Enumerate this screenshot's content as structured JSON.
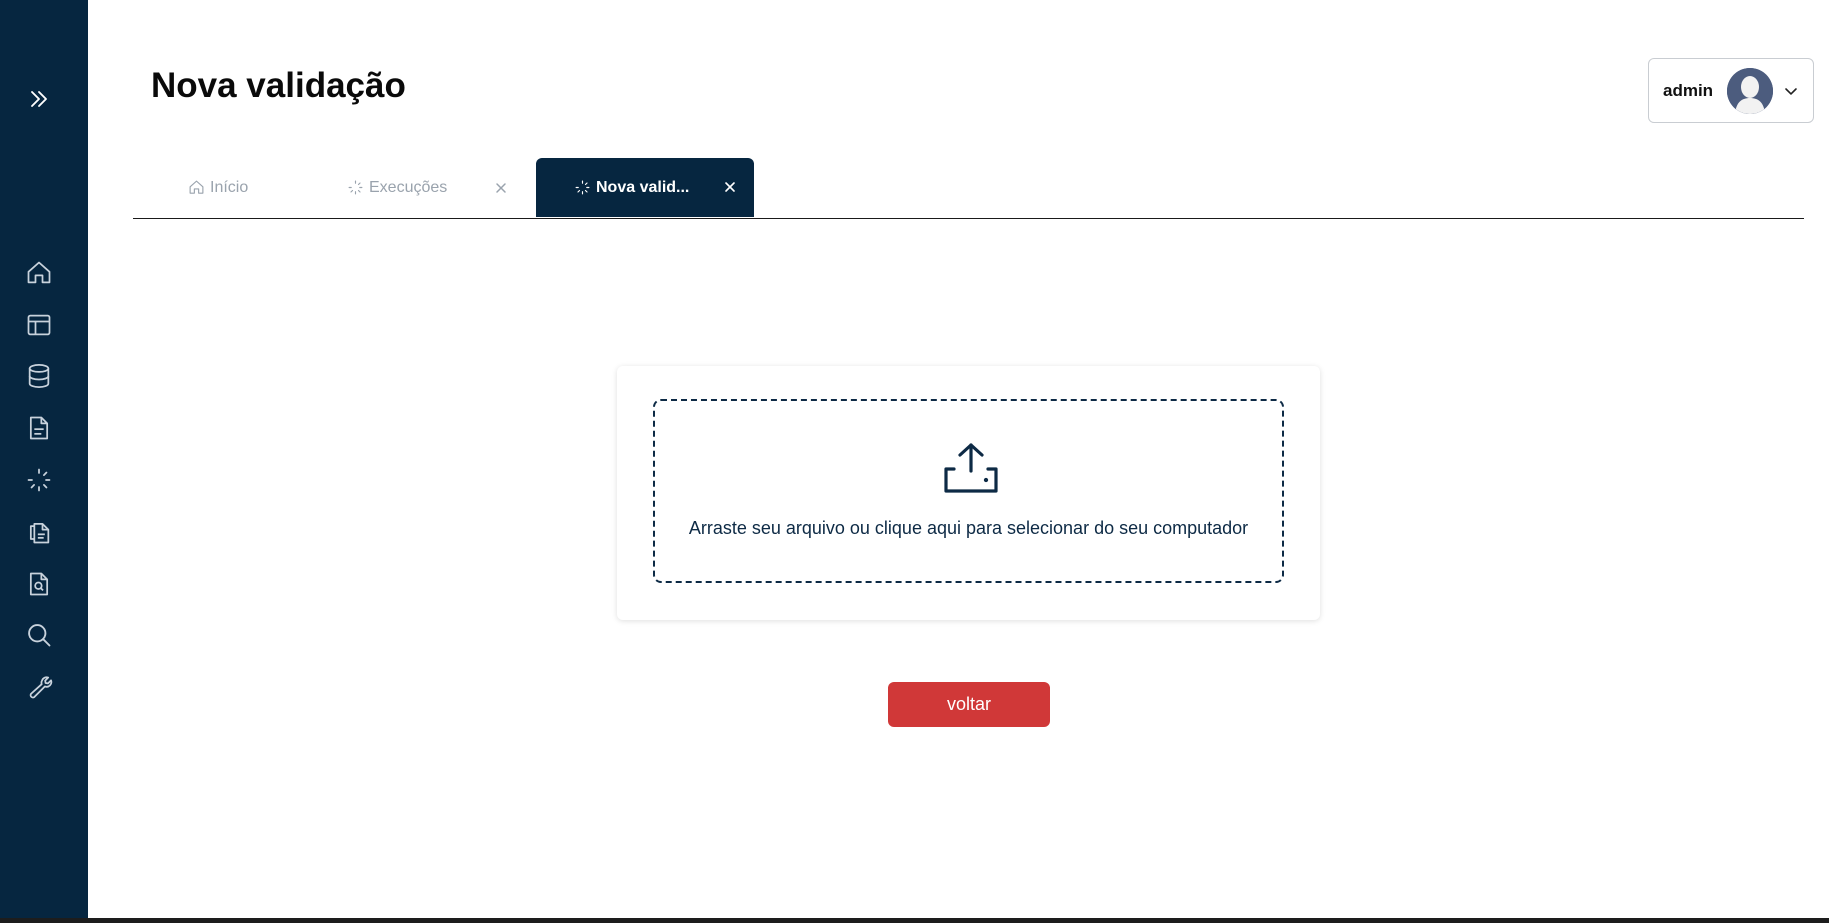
{
  "page": {
    "title": "Nova validação"
  },
  "user_menu": {
    "name": "admin",
    "avatar_icon": "user-avatar-icon",
    "dropdown_icon": "chevron-down-icon"
  },
  "sidebar": {
    "background": "#062640",
    "items": [
      {
        "icon": "expand-double-chevron-icon"
      },
      {
        "icon": "home-icon"
      },
      {
        "icon": "layout-icon"
      },
      {
        "icon": "database-icon"
      },
      {
        "icon": "document-icon"
      },
      {
        "icon": "loader-icon"
      },
      {
        "icon": "documents-icon"
      },
      {
        "icon": "file-search-icon"
      },
      {
        "icon": "search-icon"
      },
      {
        "icon": "wrench-icon"
      }
    ]
  },
  "tabs": [
    {
      "label": "Início",
      "icon": "home-icon",
      "active": false,
      "closable": false
    },
    {
      "label": "Execuções",
      "icon": "loader-icon",
      "active": false,
      "closable": true
    },
    {
      "label": "Nova valid...",
      "icon": "loader-icon",
      "active": true,
      "closable": true
    }
  ],
  "upload": {
    "icon": "upload-icon",
    "text": "Arraste seu arquivo ou clique aqui para selecionar do seu computador"
  },
  "actions": {
    "back_label": "voltar"
  },
  "colors": {
    "primary": "#062640",
    "danger": "#d03838",
    "tab_inactive_text": "#9aa3ad"
  }
}
